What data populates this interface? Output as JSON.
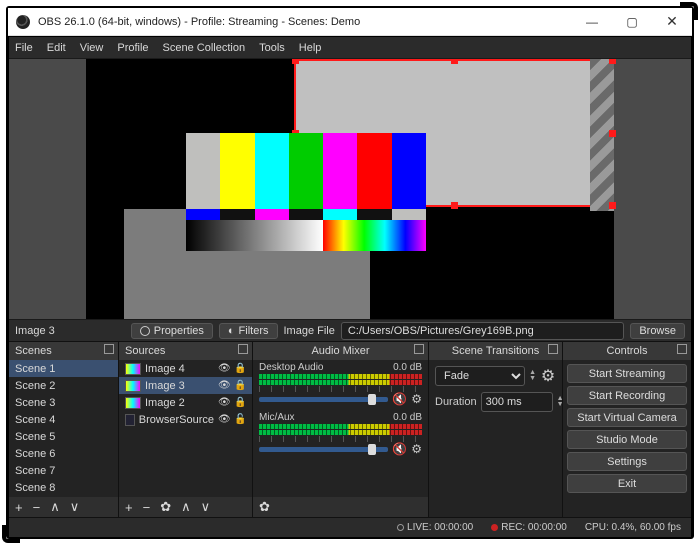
{
  "window": {
    "title": "OBS 26.1.0 (64-bit, windows) - Profile: Streaming - Scenes: Demo"
  },
  "menu": [
    "File",
    "Edit",
    "View",
    "Profile",
    "Scene Collection",
    "Tools",
    "Help"
  ],
  "selected_source": "Image 3",
  "toolbar": {
    "properties": "Properties",
    "filters": "Filters",
    "image_file_label": "Image File",
    "image_file_path": "C:/Users/OBS/Pictures/Grey169B.png",
    "browse": "Browse"
  },
  "docks": {
    "scenes": {
      "title": "Scenes",
      "items": [
        "Scene 1",
        "Scene 2",
        "Scene 3",
        "Scene 4",
        "Scene 5",
        "Scene 6",
        "Scene 7",
        "Scene 8"
      ],
      "selected_index": 0
    },
    "sources": {
      "title": "Sources",
      "items": [
        {
          "name": "Image 4",
          "locked": true
        },
        {
          "name": "Image 3",
          "locked": true
        },
        {
          "name": "Image 2",
          "locked": true
        },
        {
          "name": "BrowserSource",
          "locked": false
        }
      ],
      "selected_index": 1
    },
    "mixer": {
      "title": "Audio Mixer",
      "channels": [
        {
          "name": "Desktop Audio",
          "level": "0.0 dB"
        },
        {
          "name": "Mic/Aux",
          "level": "0.0 dB"
        }
      ]
    },
    "transitions": {
      "title": "Scene Transitions",
      "type": "Fade",
      "duration_label": "Duration",
      "duration": "300 ms"
    },
    "controls": {
      "title": "Controls",
      "buttons": [
        "Start Streaming",
        "Start Recording",
        "Start Virtual Camera",
        "Studio Mode",
        "Settings",
        "Exit"
      ]
    }
  },
  "status": {
    "live": "LIVE: 00:00:00",
    "rec": "REC: 00:00:00",
    "cpu": "CPU: 0.4%, 60.00 fps"
  }
}
